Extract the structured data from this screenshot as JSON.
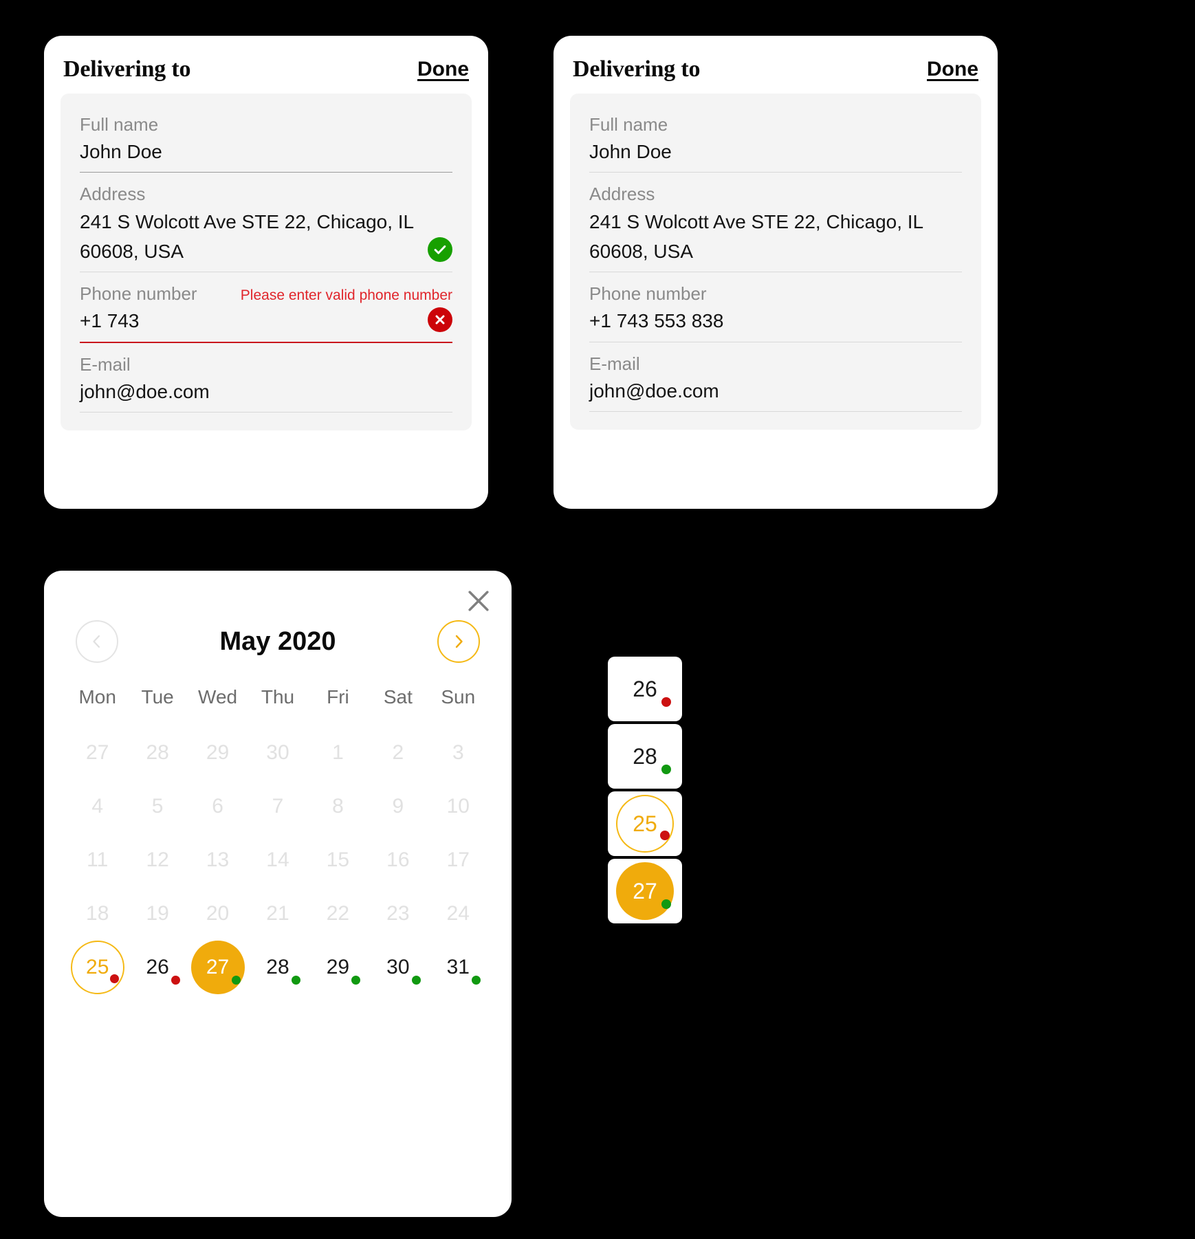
{
  "delivery_form": {
    "title": "Delivering to",
    "done_label": "Done",
    "fields": {
      "full_name": {
        "label": "Full name",
        "value": "John Doe"
      },
      "address": {
        "label": "Address",
        "value": "241 S Wolcott Ave STE 22, Chicago, IL 60608, USA"
      },
      "phone": {
        "label": "Phone number",
        "value_invalid": "+1 743",
        "value_valid": "+1 743 553 838",
        "error": "Please enter valid phone number"
      },
      "email": {
        "label": "E-mail",
        "value": "john@doe.com"
      }
    },
    "icons": {
      "valid": "check-circle-icon",
      "invalid": "error-circle-icon"
    }
  },
  "calendar": {
    "month_label": "May 2020",
    "close_icon": "close-icon",
    "prev_icon": "chevron-left-icon",
    "next_icon": "chevron-right-icon",
    "prev_enabled": false,
    "next_enabled": true,
    "weekdays": [
      "Mon",
      "Tue",
      "Wed",
      "Thu",
      "Fri",
      "Sat",
      "Sun"
    ],
    "weeks": [
      [
        {
          "d": "27",
          "state": "muted"
        },
        {
          "d": "28",
          "state": "muted"
        },
        {
          "d": "29",
          "state": "muted"
        },
        {
          "d": "30",
          "state": "muted"
        },
        {
          "d": "1",
          "state": "muted"
        },
        {
          "d": "2",
          "state": "muted"
        },
        {
          "d": "3",
          "state": "muted"
        }
      ],
      [
        {
          "d": "4",
          "state": "muted"
        },
        {
          "d": "5",
          "state": "muted"
        },
        {
          "d": "6",
          "state": "muted"
        },
        {
          "d": "7",
          "state": "muted"
        },
        {
          "d": "8",
          "state": "muted"
        },
        {
          "d": "9",
          "state": "muted"
        },
        {
          "d": "10",
          "state": "muted"
        }
      ],
      [
        {
          "d": "11",
          "state": "muted"
        },
        {
          "d": "12",
          "state": "muted"
        },
        {
          "d": "13",
          "state": "muted"
        },
        {
          "d": "14",
          "state": "muted"
        },
        {
          "d": "15",
          "state": "muted"
        },
        {
          "d": "16",
          "state": "muted"
        },
        {
          "d": "17",
          "state": "muted"
        }
      ],
      [
        {
          "d": "18",
          "state": "muted"
        },
        {
          "d": "19",
          "state": "muted"
        },
        {
          "d": "20",
          "state": "muted"
        },
        {
          "d": "21",
          "state": "muted"
        },
        {
          "d": "22",
          "state": "muted"
        },
        {
          "d": "23",
          "state": "muted"
        },
        {
          "d": "24",
          "state": "muted"
        }
      ],
      [
        {
          "d": "25",
          "state": "outlined",
          "dot": "red"
        },
        {
          "d": "26",
          "state": "default",
          "dot": "red"
        },
        {
          "d": "27",
          "state": "filled",
          "dot": "green"
        },
        {
          "d": "28",
          "state": "default",
          "dot": "green"
        },
        {
          "d": "29",
          "state": "default",
          "dot": "green"
        },
        {
          "d": "30",
          "state": "default",
          "dot": "green"
        },
        {
          "d": "31",
          "state": "default",
          "dot": "green"
        }
      ]
    ]
  },
  "day_states_legend": [
    {
      "d": "26",
      "state": "default",
      "dot": "red"
    },
    {
      "d": "28",
      "state": "default",
      "dot": "green"
    },
    {
      "d": "25",
      "state": "outlined",
      "dot": "red"
    },
    {
      "d": "27",
      "state": "filled",
      "dot": "green"
    }
  ],
  "colors": {
    "accent": "#f0ab0c",
    "accent_outline": "#f5b915",
    "success": "#17a000",
    "error": "#cc0409",
    "error_text": "#e0252b",
    "dot_red": "#cc1111",
    "dot_green": "#119911",
    "field_bg": "#f4f4f4",
    "muted_text": "#e1e1e1"
  }
}
